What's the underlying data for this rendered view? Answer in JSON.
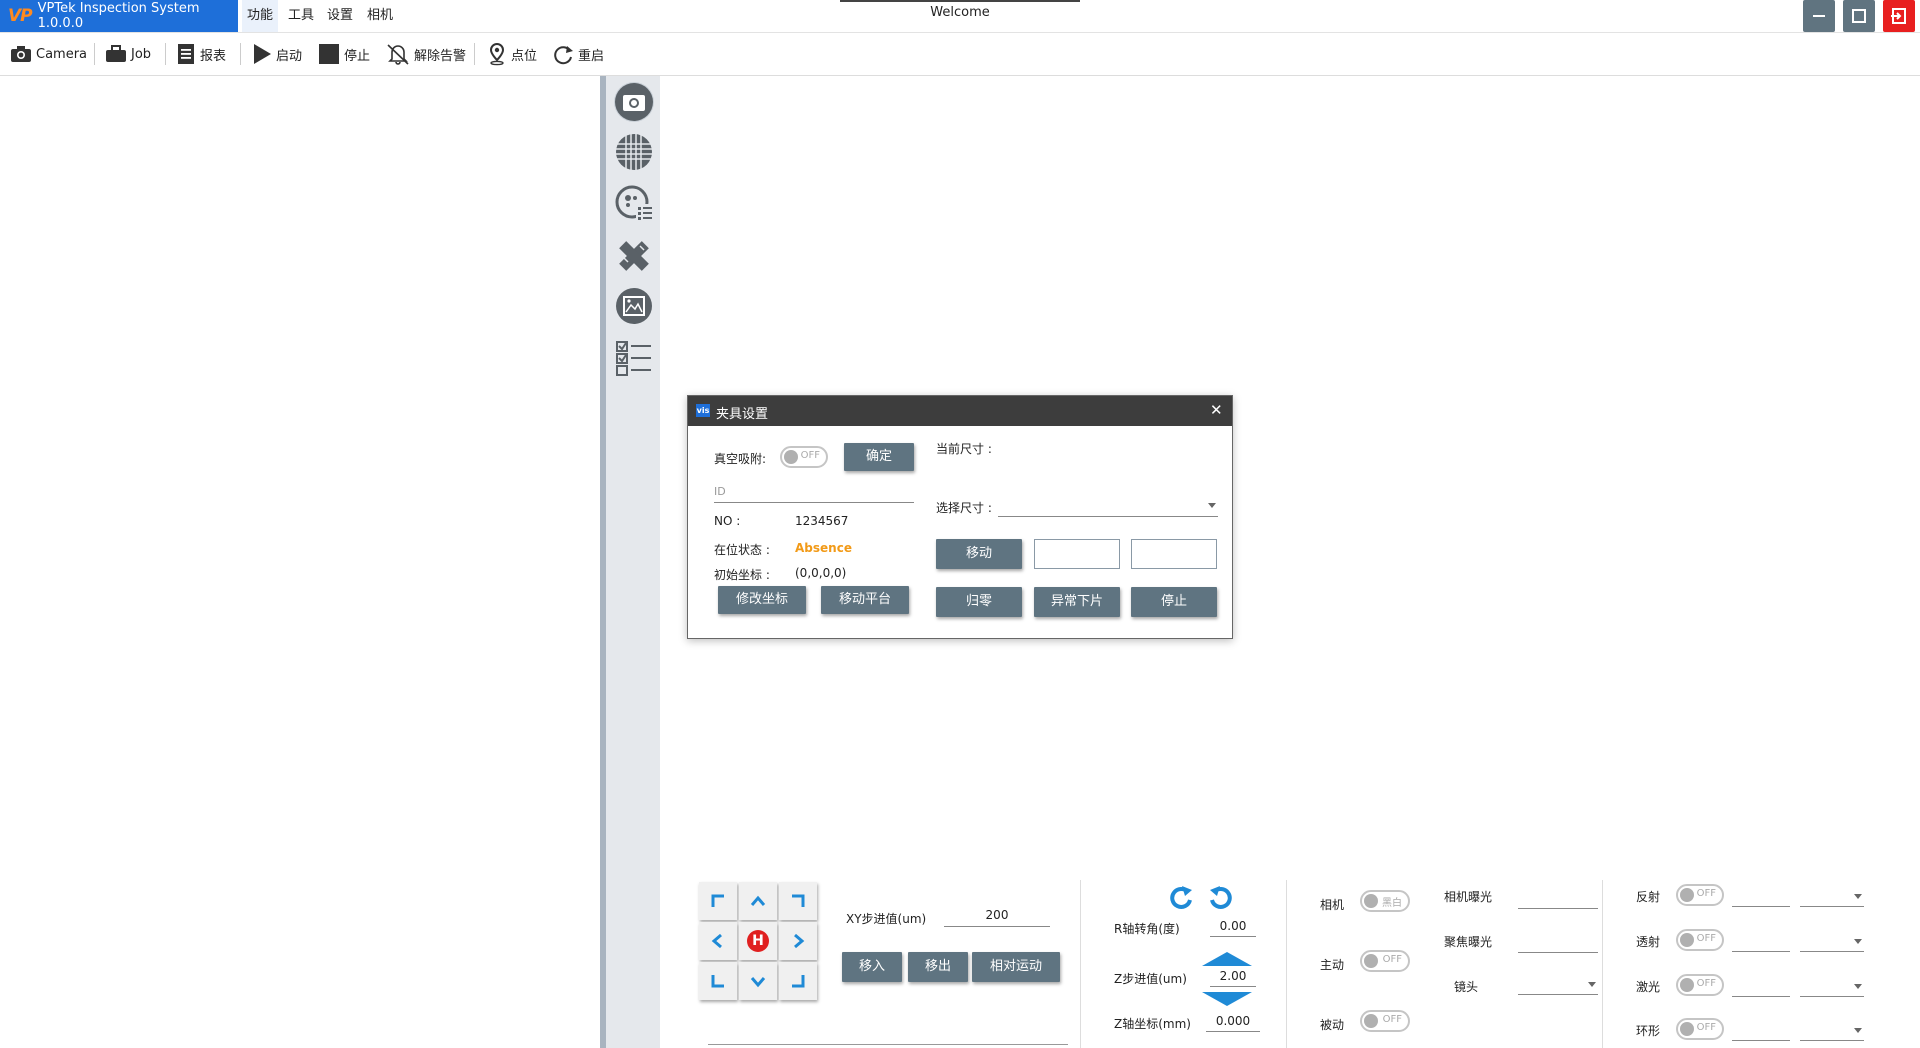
{
  "app": {
    "logo": "VP",
    "title": "VPTek Inspection System 1.0.0.0",
    "menu": [
      "功能",
      "工具",
      "设置",
      "相机"
    ],
    "tab_title": "Welcome"
  },
  "toolbar": {
    "camera": "Camera",
    "job": "Job",
    "report": "报表",
    "start": "启动",
    "stop": "停止",
    "clear_alarm": "解除告警",
    "point": "点位",
    "restart": "重启"
  },
  "dialog": {
    "title": "夹具设置",
    "vis_badge": "vis",
    "close": "✕",
    "vacuum_label": "真空吸附:",
    "vacuum_toggle": "OFF",
    "confirm": "确定",
    "id_placeholder": "ID",
    "no_label": "NO :",
    "no_value": "1234567",
    "status_label": "在位状态 :",
    "status_value": "Absence",
    "status_color": "#f29a17",
    "init_coord_label": "初始坐标 :",
    "init_coord_value": "(0,0,0,0)",
    "modify_coord": "修改坐标",
    "move_platform": "移动平台",
    "current_size_label": "当前尺寸 :",
    "select_size_label": "选择尺寸 :",
    "move": "移动",
    "home": "归零",
    "abnormal_unload": "异常下片",
    "stop": "停止"
  },
  "motion": {
    "xy_step_label": "XY步进值(um)",
    "xy_step_value": "200",
    "move_in": "移入",
    "move_out": "移出",
    "relative_move": "相对运动",
    "home_symbol": "H",
    "r_angle_label": "R轴转角(度)",
    "r_angle_value": "0.00",
    "z_step_label": "Z步进值(um)",
    "z_step_value": "2.00",
    "z_coord_label": "Z轴坐标(mm)",
    "z_coord_value": "0.000"
  },
  "camera_ctrl": {
    "camera_label": "相机",
    "camera_toggle": "黑白",
    "active_label": "主动",
    "active_toggle": "OFF",
    "passive_label": "被动",
    "passive_toggle": "OFF",
    "exposure_label": "相机曝光",
    "focus_exposure_label": "聚焦曝光",
    "lens_label": "镜头"
  },
  "lights": [
    {
      "label": "反射",
      "toggle": "OFF"
    },
    {
      "label": "透射",
      "toggle": "OFF"
    },
    {
      "label": "激光",
      "toggle": "OFF"
    },
    {
      "label": "环形",
      "toggle": "OFF"
    }
  ],
  "colors": {
    "brand_blue": "#1e6fd9",
    "accent_orange": "#ff8a1f",
    "button_slate": "#5f7481",
    "arrow_blue": "#1f8ad6",
    "home_red": "#e02020"
  }
}
